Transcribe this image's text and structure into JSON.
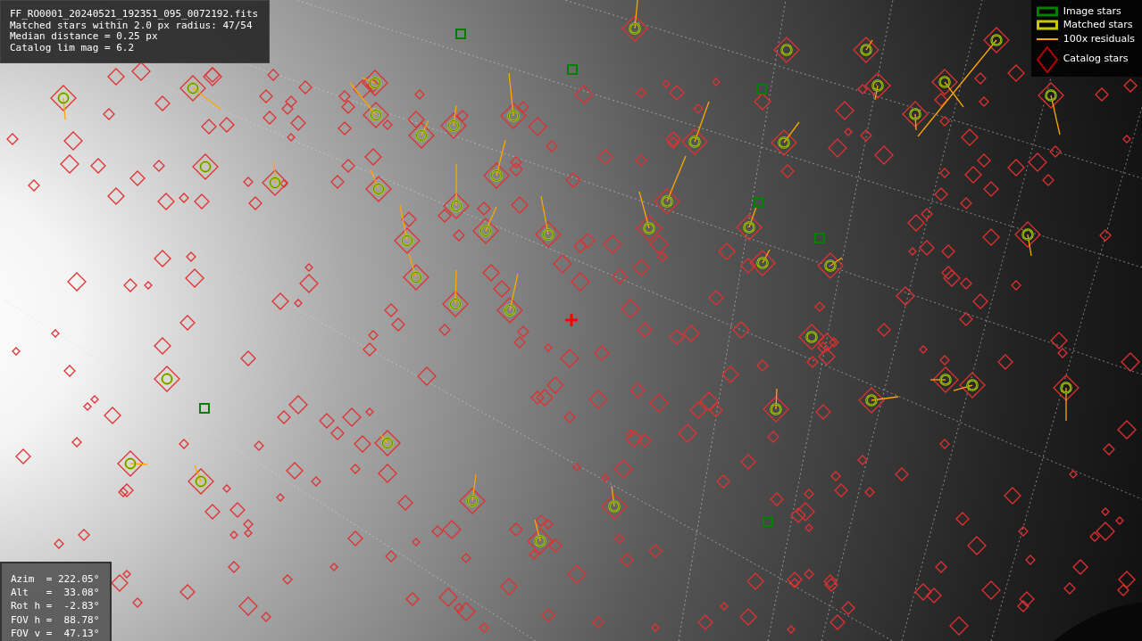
{
  "info_box": {
    "lines": [
      "FF_RO0001_20240521_192351_095_0072192.fits",
      "Matched stars within 2.0 px radius: 47/54",
      "Median distance = 0.25 px",
      "Catalog lim mag = 6.2"
    ]
  },
  "legend": {
    "items": [
      {
        "kind": "image",
        "label": "Image stars",
        "color": "#008000"
      },
      {
        "kind": "matched",
        "label": "Matched stars",
        "color": "#c8c800"
      },
      {
        "kind": "residual",
        "label": "100x residuals",
        "color": "#ffa500"
      },
      {
        "kind": "catalog",
        "label": "Catalog stars",
        "color": "#c00000"
      }
    ]
  },
  "pointing_box": {
    "lines": [
      "Azim  = 222.05°",
      "Alt   =  33.08°",
      "Rot h =  -2.83°",
      "FOV h =  88.78°",
      "FOV v =  47.13°"
    ]
  }
}
